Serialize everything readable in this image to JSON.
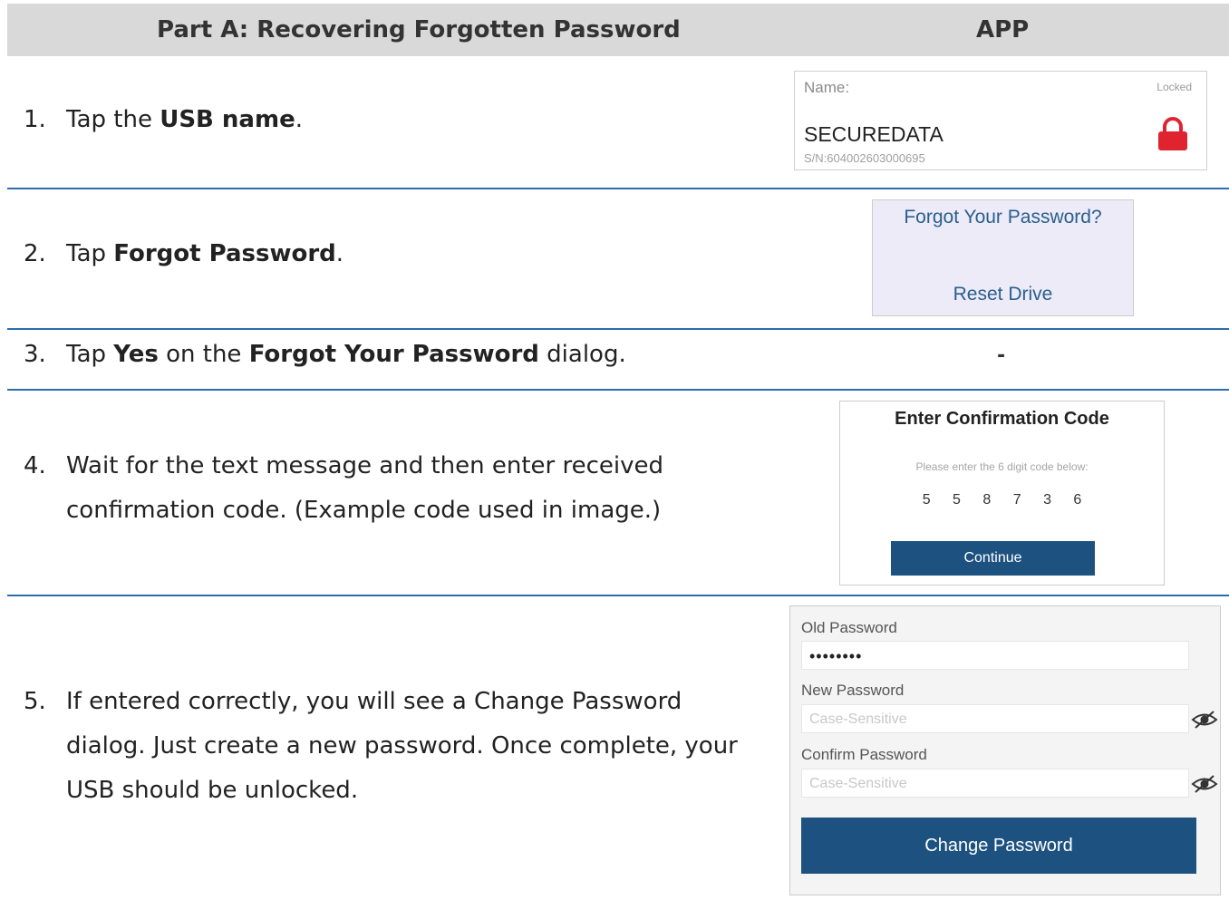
{
  "header": {
    "left_title": "Part A: Recovering Forgotten Password",
    "right_title": "APP"
  },
  "steps": [
    {
      "num": "1.",
      "pre": "Tap the ",
      "bold": "USB name",
      "post": "."
    },
    {
      "num": "2.",
      "pre": "Tap ",
      "bold": "Forgot Password",
      "post": "."
    },
    {
      "num": "3.",
      "pre": "Tap ",
      "bold": "Yes",
      "mid": " on the ",
      "bold2": "Forgot Your Password",
      "post": " dialog."
    },
    {
      "num": "4.",
      "line1": "Wait for the text message and then enter received",
      "line2": "confirmation code. (Example code used in image.)"
    },
    {
      "num": "5.",
      "line1": "If entered correctly, you will see a Change Password",
      "line2": "dialog. Just create a new password. Once complete, your",
      "line3": "USB should be unlocked."
    }
  ],
  "usb_card": {
    "name_label": "Name:",
    "status": "Locked",
    "usb_name": "SECUREDATA",
    "serial": "S/N:604002603000695",
    "lock_color": "#e0242f"
  },
  "forgot_card": {
    "forgot_link": "Forgot Your Password?",
    "reset_link": "Reset Drive"
  },
  "step3_app": "-",
  "code_card": {
    "title": "Enter Confirmation Code",
    "subtitle": "Please enter the 6 digit code below:",
    "code": "5 5 8 7 3 6",
    "button": "Continue"
  },
  "password_card": {
    "old_label": "Old Password",
    "old_value": "••••••••",
    "new_label": "New Password",
    "new_placeholder": "Case-Sensitive",
    "confirm_label": "Confirm Password",
    "confirm_placeholder": "Case-Sensitive",
    "button": "Change Password"
  },
  "colors": {
    "header_bg": "#d9d9d9",
    "divider": "#2e6ea8",
    "button": "#1d5280",
    "link": "#2b5e8f"
  }
}
